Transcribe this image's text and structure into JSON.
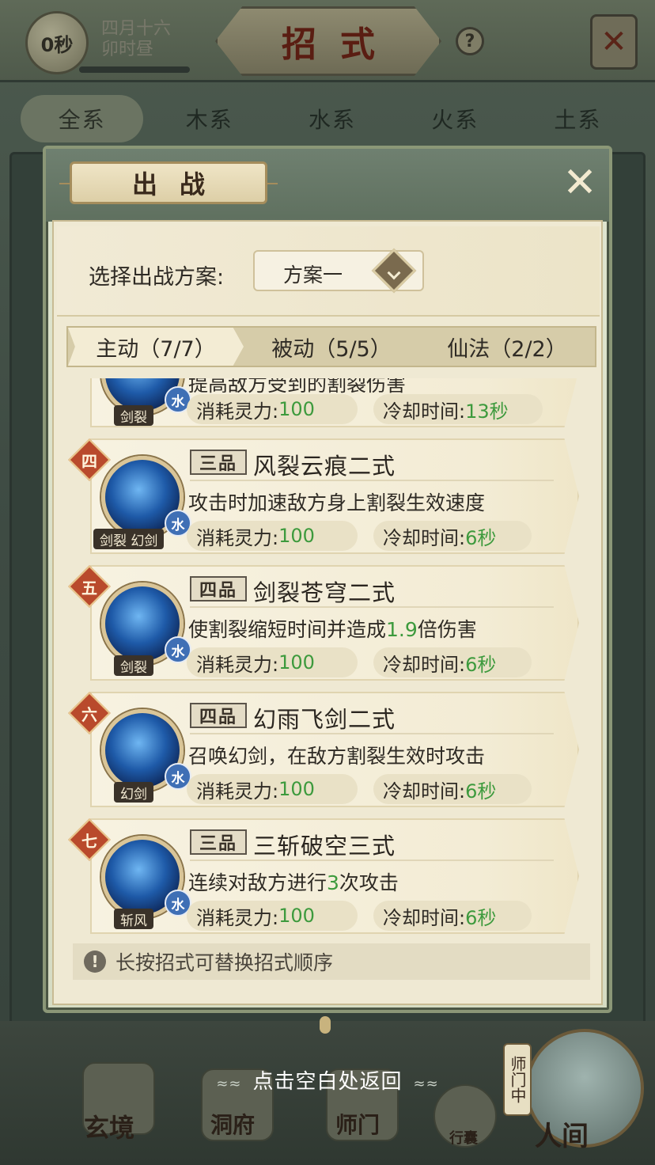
{
  "background": {
    "timer": "0秒",
    "date_line1": "四月十六",
    "date_line2": "卯时昼",
    "title": "招式",
    "help": "?",
    "element_tabs": [
      "全系",
      "木系",
      "水系",
      "火系",
      "土系"
    ],
    "return_hint": "点击空白处返回",
    "nav": {
      "xuanjing": "玄境",
      "dongfu": "洞府",
      "shimen": "师门",
      "xingnang": "行囊",
      "renjian": "人间",
      "side_badge": "师门中"
    }
  },
  "modal": {
    "title": "出战",
    "plan_label": "选择出战方案:",
    "plan_value": "方案一",
    "tabs": [
      "主动（7/7）",
      "被动（5/5）",
      "仙法（2/2）"
    ],
    "tip": "长按招式可替换招式顺序",
    "skills": [
      {
        "order": "",
        "grade": "",
        "name": "",
        "desc": "提高敌方受到的割裂伤害",
        "type_label": "剑裂",
        "element": "水",
        "cost_label": "消耗灵力:",
        "cost": "100",
        "cd_label": "冷却时间:",
        "cd": "13秒"
      },
      {
        "order": "四",
        "grade": "三品",
        "name": "风裂云痕二式",
        "desc": "攻击时加速敌方身上割裂生效速度",
        "type_label": "剑裂 幻剑",
        "element": "水",
        "cost_label": "消耗灵力:",
        "cost": "100",
        "cd_label": "冷却时间:",
        "cd": "6秒"
      },
      {
        "order": "五",
        "grade": "四品",
        "name": "剑裂苍穹二式",
        "desc_pre": "使割裂缩短时间并造成",
        "desc_num": "1.9",
        "desc_post": "倍伤害",
        "type_label": "剑裂",
        "element": "水",
        "cost_label": "消耗灵力:",
        "cost": "100",
        "cd_label": "冷却时间:",
        "cd": "6秒"
      },
      {
        "order": "六",
        "grade": "四品",
        "name": "幻雨飞剑二式",
        "desc": "召唤幻剑，在敌方割裂生效时攻击",
        "type_label": "幻剑",
        "element": "水",
        "cost_label": "消耗灵力:",
        "cost": "100",
        "cd_label": "冷却时间:",
        "cd": "6秒"
      },
      {
        "order": "七",
        "grade": "三品",
        "name": "三斩破空三式",
        "desc_pre": "连续对敌方进行",
        "desc_num": "3",
        "desc_post": "次攻击",
        "type_label": "斩风",
        "element": "水",
        "cost_label": "消耗灵力:",
        "cost": "100",
        "cd_label": "冷却时间:",
        "cd": "6秒"
      }
    ]
  },
  "colors": {
    "accent_green": "#3d9a3d",
    "order_badge": "#b94a2c",
    "water_badge": "#3f6fb5"
  }
}
